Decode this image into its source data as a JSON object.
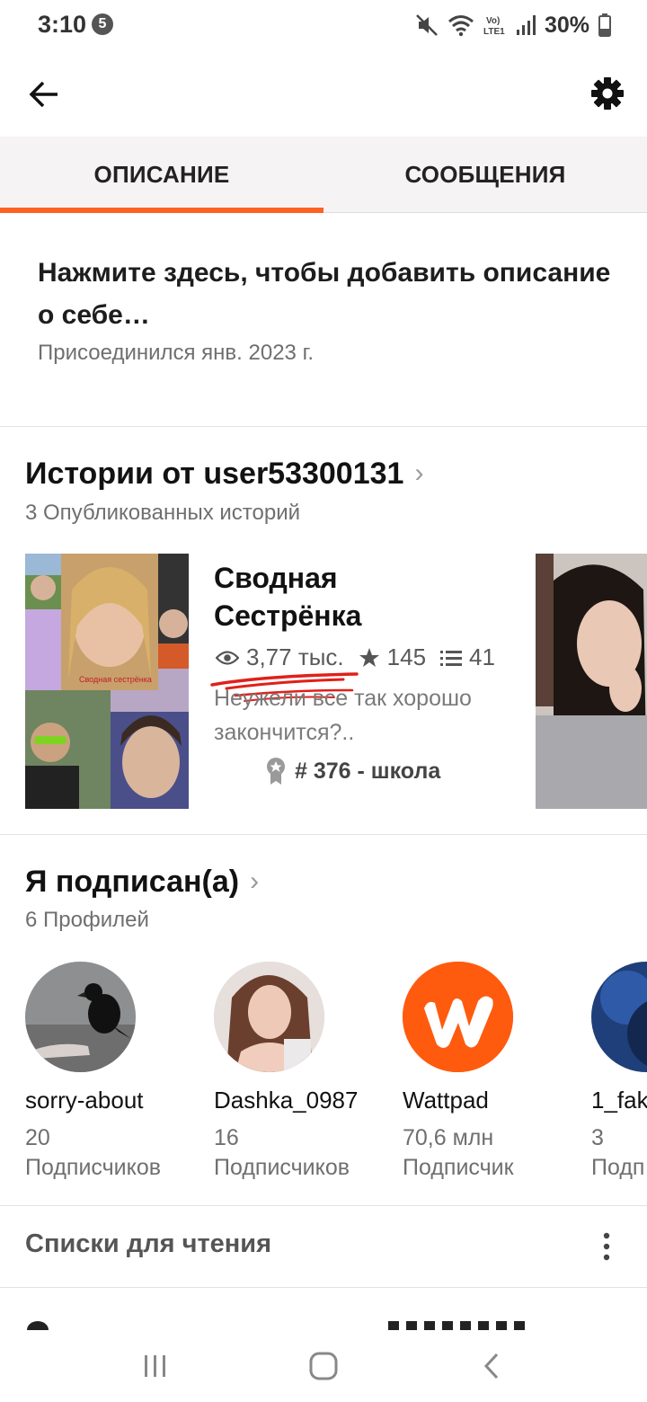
{
  "status_bar": {
    "time": "3:10",
    "notification_count": "5",
    "battery": "30%"
  },
  "tabs": [
    {
      "label": "ОПИСАНИЕ",
      "active": true
    },
    {
      "label": "СООБЩЕНИЯ",
      "active": false
    }
  ],
  "description": {
    "prompt": "Нажмите здесь, чтобы добавить описание о себе…",
    "joined": "Присоединился янв. 2023 г."
  },
  "stories_section": {
    "title": "Истории от user53300131",
    "subtitle": "3 Опубликованных историй",
    "story": {
      "title": "Сводная Сестрёнка",
      "views": "3,77 тыс.",
      "votes": "145",
      "parts": "41",
      "description": "Неужели все так хорошо закончится?..",
      "rank": "# 376 - школа"
    }
  },
  "following_section": {
    "title": "Я подписан(а)",
    "subtitle": "6 Профилей",
    "profiles": [
      {
        "name": "sorry-about",
        "count": "20",
        "label": "Подписчиков"
      },
      {
        "name": "Dashka_0987",
        "count": "16",
        "label": "Подписчиков"
      },
      {
        "name": "Wattpad",
        "count": "70,6 млн",
        "label": "Подписчик"
      },
      {
        "name": "1_fak",
        "count": "3",
        "label": "Подп"
      }
    ]
  },
  "reading_lists": {
    "title": "Списки для чтения"
  },
  "colors": {
    "accent": "#ff6122",
    "wattpad_orange": "#ff5b0f"
  }
}
